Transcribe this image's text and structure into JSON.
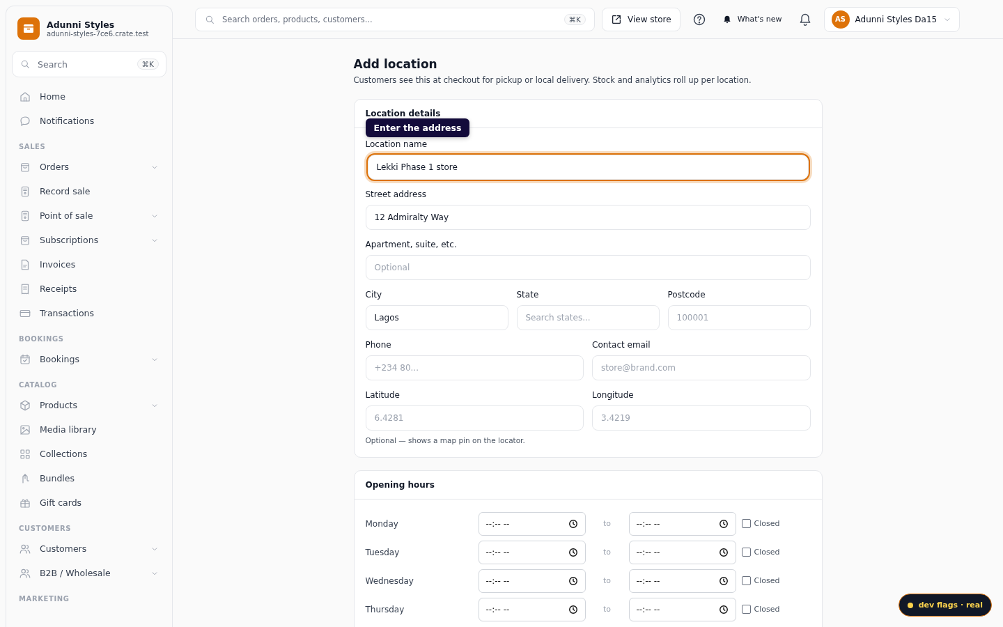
{
  "sidebar": {
    "store_name": "Adunni Styles",
    "store_domain": "adunni-styles-7ce6.crate.test",
    "search": {
      "placeholder": "Search",
      "shortcut": "⌘K"
    },
    "sections": [
      {
        "items": [
          {
            "label": "Home",
            "expandable": false
          },
          {
            "label": "Notifications",
            "expandable": false
          }
        ]
      },
      {
        "title": "SALES",
        "items": [
          {
            "label": "Orders",
            "expandable": true
          },
          {
            "label": "Record sale",
            "expandable": false
          },
          {
            "label": "Point of sale",
            "expandable": true
          },
          {
            "label": "Subscriptions",
            "expandable": true
          },
          {
            "label": "Invoices",
            "expandable": false
          },
          {
            "label": "Receipts",
            "expandable": false
          },
          {
            "label": "Transactions",
            "expandable": false
          }
        ]
      },
      {
        "title": "BOOKINGS",
        "items": [
          {
            "label": "Bookings",
            "expandable": true
          }
        ]
      },
      {
        "title": "CATALOG",
        "items": [
          {
            "label": "Products",
            "expandable": true
          },
          {
            "label": "Media library",
            "expandable": false
          },
          {
            "label": "Collections",
            "expandable": false
          },
          {
            "label": "Bundles",
            "expandable": false
          },
          {
            "label": "Gift cards",
            "expandable": false
          }
        ]
      },
      {
        "title": "CUSTOMERS",
        "items": [
          {
            "label": "Customers",
            "expandable": true
          },
          {
            "label": "B2B / Wholesale",
            "expandable": true
          }
        ]
      },
      {
        "title": "MARKETING"
      }
    ]
  },
  "topbar": {
    "search": {
      "placeholder": "Search orders, products, customers...",
      "shortcut": "⌘K"
    },
    "view_store": "View store",
    "whats_new": "What's new",
    "account": {
      "initials": "AS",
      "name": "Adunni Styles Da15"
    }
  },
  "page": {
    "title": "Add location",
    "subtitle": "Customers see this at checkout for pickup or local delivery. Stock and analytics roll up per location.",
    "location_details": {
      "title": "Location details",
      "tooltip": "Enter the address",
      "rows": [
        [
          {
            "label": "Location name",
            "value": "Lekki Phase 1 store",
            "focused": true
          }
        ],
        [
          {
            "label": "Street address",
            "value": "12 Admiralty Way",
            "focused": false
          }
        ],
        [
          {
            "label": "Apartment, suite, etc.",
            "placeholder": "Optional",
            "focused": false
          }
        ],
        [
          {
            "label": "City",
            "value": "Lagos",
            "focused": false
          },
          {
            "label": "State",
            "placeholder": "Search states...",
            "focused": false
          },
          {
            "label": "Postcode",
            "placeholder": "100001",
            "focused": false
          }
        ],
        [
          {
            "label": "Phone",
            "placeholder": "+234 80...",
            "focused": false
          },
          {
            "label": "Contact email",
            "placeholder": "store@brand.com",
            "focused": false
          }
        ],
        [
          {
            "label": "Latitude",
            "placeholder": "6.4281",
            "focused": false
          },
          {
            "label": "Longitude",
            "placeholder": "3.4219",
            "focused": false
          }
        ]
      ],
      "hint": "Optional — shows a map pin on the locator."
    },
    "opening_hours": {
      "title": "Opening hours",
      "days": [
        {
          "day": "Monday",
          "open": "--:-- --",
          "separator": "to",
          "close": "--:-- --",
          "closed_label": "Closed",
          "closed": false
        },
        {
          "day": "Tuesday",
          "open": "--:-- --",
          "separator": "to",
          "close": "--:-- --",
          "closed_label": "Closed",
          "closed": false
        },
        {
          "day": "Wednesday",
          "open": "--:-- --",
          "separator": "to",
          "close": "--:-- --",
          "closed_label": "Closed",
          "closed": false
        },
        {
          "day": "Thursday",
          "open": "--:-- --",
          "separator": "to",
          "close": "--:-- --",
          "closed_label": "Closed",
          "closed": false
        }
      ]
    }
  },
  "dev_badge": "dev flags · real"
}
